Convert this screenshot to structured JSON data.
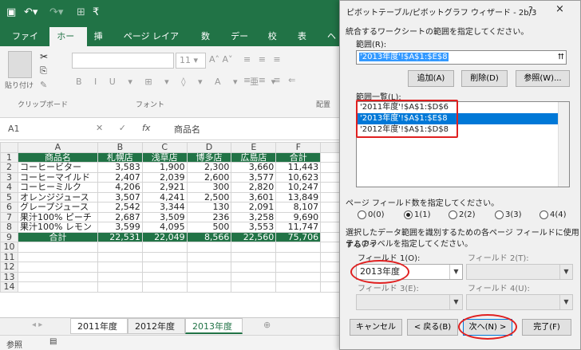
{
  "ribbon": {
    "tabs": [
      "ファイル",
      "ホーム",
      "挿入",
      "ページ レイアウト",
      "数式",
      "データ",
      "校閲",
      "表示",
      "ヘ"
    ],
    "font_size": "11",
    "groups": {
      "clipboard": "クリップボード",
      "font": "フォント",
      "align": "配置"
    },
    "paste": "貼り付け"
  },
  "formula": {
    "cell": "A1",
    "fx": "fx",
    "value": "商品名"
  },
  "columns": [
    "A",
    "B",
    "C",
    "D",
    "E",
    "F"
  ],
  "header_row": [
    "商品名",
    "札幌店",
    "浅草店",
    "博多店",
    "広島店",
    "合計"
  ],
  "rows": [
    [
      "コーヒービター",
      "3,583",
      "1,900",
      "2,300",
      "3,660",
      "11,443"
    ],
    [
      "コーヒーマイルド",
      "2,407",
      "2,039",
      "2,600",
      "3,577",
      "10,623"
    ],
    [
      "コーヒーミルク",
      "4,206",
      "2,921",
      "300",
      "2,820",
      "10,247"
    ],
    [
      "オレンジジュース",
      "3,507",
      "4,241",
      "2,500",
      "3,601",
      "13,849"
    ],
    [
      "グレープジュース",
      "2,542",
      "3,344",
      "130",
      "2,091",
      "8,107"
    ],
    [
      "果汁100% ピーチ",
      "2,687",
      "3,509",
      "236",
      "3,258",
      "9,690"
    ],
    [
      "果汁100% レモン",
      "3,599",
      "4,095",
      "500",
      "3,553",
      "11,747"
    ]
  ],
  "total_row": [
    "合計",
    "22,531",
    "22,049",
    "8,566",
    "22,560",
    "75,706"
  ],
  "sheets": [
    "2011年度",
    "2012年度",
    "2013年度"
  ],
  "status": "参照",
  "dialog": {
    "title": "ピボットテーブル/ピボットグラフ ウィザード - 2b/3",
    "help": "?",
    "close": "×",
    "instruction": "統合するワークシートの範囲を指定してください。",
    "range_label": "範囲(R):",
    "range_value": "'2013年度'!$A$1:$E$8",
    "add": "追加(A)",
    "delete": "削除(D)",
    "browse": "参照(W)...",
    "list_label": "範囲一覧(L):",
    "ranges": [
      "'2011年度'!$A$1:$D$6",
      "'2013年度'!$A$1:$E$8",
      "'2012年度'!$A$1:$D$8"
    ],
    "selected_index": 1,
    "page_label": "ページ フィールド数を指定してください。",
    "page_options": [
      "0(0)",
      "1(1)",
      "2(2)",
      "3(3)",
      "4(4)"
    ],
    "page_selected": 1,
    "label_instr_1": "選択したデータ範囲を識別するための各ページ フィールドに使用するアイ",
    "label_instr_2": "テムのラベルを指定してください。",
    "field1_label": "フィールド 1(O):",
    "field1_value": "2013年度",
    "field2_label": "フィールド 2(T):",
    "field3_label": "フィールド 3(E):",
    "field4_label": "フィールド 4(U):",
    "cancel": "キャンセル",
    "back": "< 戻る(B)",
    "next": "次へ(N) >",
    "finish": "完了(F)"
  }
}
